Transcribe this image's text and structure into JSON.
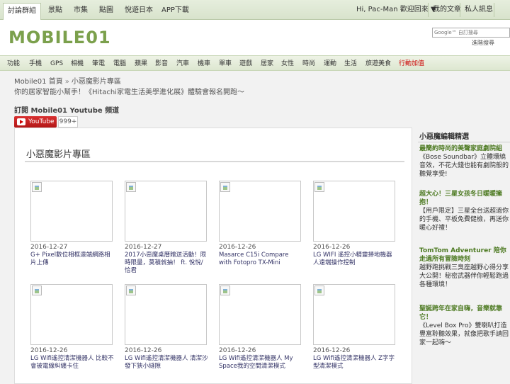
{
  "topbar": {
    "tabs": [
      "討論群組",
      "景點",
      "市集",
      "點圖",
      "悅遊日本",
      "APP下載"
    ],
    "greeting": "Hi, Pac-Man 歡迎回來",
    "links": [
      "我的文章",
      "私人訊息"
    ]
  },
  "logo": {
    "text": "MOBILE01"
  },
  "search": {
    "placeholder": "Google™ 自訂搜尋",
    "advanced": "進階搜尋"
  },
  "nav": {
    "items": [
      "功能",
      "手機",
      "GPS",
      "相機",
      "筆電",
      "電腦",
      "蘋果",
      "影音",
      "汽車",
      "機車",
      "單車",
      "遊戲",
      "居家",
      "女性",
      "時尚",
      "運動",
      "生活",
      "旅遊美食",
      "行動加值"
    ]
  },
  "breadcrumb": {
    "home": "Mobile01 首頁",
    "separator": "»",
    "current": "小惡魔影片專區"
  },
  "promo": "你的居家智能小幫手！《Hitachi家電生活美學進化展》體驗會報名開跑～",
  "youtube": {
    "subscribe_label": "訂閱 Mobile01 Youtube 頻道",
    "button": "YouTube",
    "count": "999+"
  },
  "main": {
    "title": "小惡魔影片專區",
    "videos": [
      {
        "date": "2016-12-27",
        "title": "G+ Pixel數位相框遠端網路相片上傳"
      },
      {
        "date": "2016-12-27",
        "title": "2017小惡魔桌曆贈送活動！限時限量，莫積就抽！ ft. 悅悅/恰君"
      },
      {
        "date": "2016-12-26",
        "title": "Masarce C15i Compare with Fotopro TX-Mini"
      },
      {
        "date": "2016-12-26",
        "title": "LG WIFI 遙控小精靈掃地機器人遠端操作控制"
      },
      {
        "date": "2016-12-26",
        "title": "LG Wifi遙控清潔機器人 比較不會被電線糾纏卡住"
      },
      {
        "date": "2016-12-26",
        "title": "LG Wifi遙控清潔機器人 清潔沙發下狹小縫隙"
      },
      {
        "date": "2016-12-26",
        "title": "LG Wifi遙控清潔機器人 My Space我的空間清潔模式"
      },
      {
        "date": "2016-12-26",
        "title": "LG Wifi遙控清潔機器人 Z字字型清潔模式"
      }
    ]
  },
  "sidebar": {
    "title": "小惡魔編輯精選",
    "news": [
      {
        "head": "最簡約時尚的美聲家庭劇院組",
        "body": "《Bose Soundbar》立體環繞音效，不花大錢也能有劇院般的聽覺享受!"
      },
      {
        "head": "超大心！三星女孩冬日暖暖擁抱！",
        "body": "【用戶限定】三星全台送超過你的手機、平板免費健檢，再送你暖心好禮！"
      },
      {
        "head": "TomTom Adventurer 陪你走過所有冒險時刻",
        "body": "越野跑挑戰三臭座越野心得分享大公開！秘密武器伴你輕鬆跑過各種環境！"
      },
      {
        "head": "聖誕跨年在家自嗨，音樂就靠它！",
        "body": "《Level Box Pro》雙喇叭打造豐富聆聽效果，就像把歌手請回家一起嗨～"
      }
    ]
  }
}
